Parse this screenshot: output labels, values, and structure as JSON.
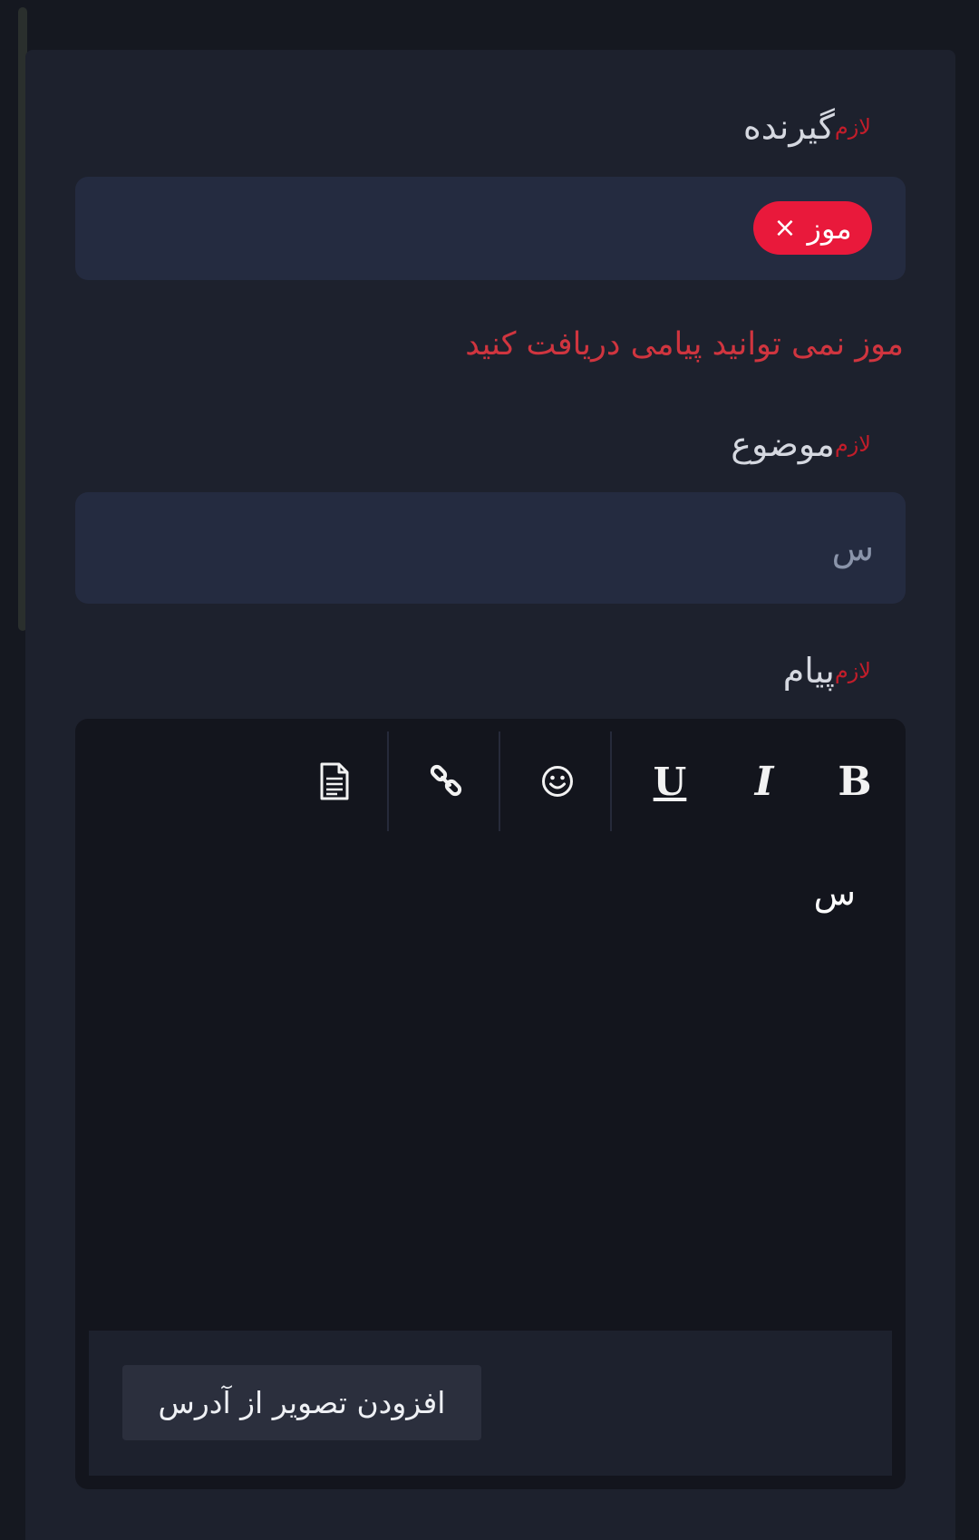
{
  "form": {
    "recipient": {
      "label": "گیرنده",
      "required_text": "لازم",
      "chips": [
        {
          "label": "موز",
          "remove": "×"
        }
      ],
      "error": "موز نمی توانید پیامی دریافت کنید"
    },
    "subject": {
      "label": "موضوع",
      "required_text": "لازم",
      "value": "س"
    },
    "message": {
      "label": "پیام",
      "required_text": "لازم",
      "toolbar": {
        "bold": "B",
        "italic": "I",
        "underline": "U",
        "emoji_icon": "smiley-icon",
        "link_icon": "link-icon",
        "document_icon": "document-icon"
      },
      "content": "س",
      "add_image_label": "افزودن تصویر از آدرس"
    }
  }
}
